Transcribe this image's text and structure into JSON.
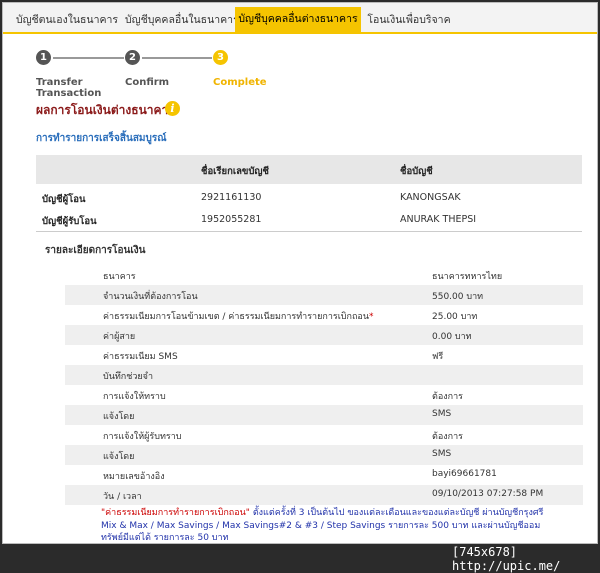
{
  "tabs": [
    {
      "label": "บัญชีตนเองในธนาคาร",
      "active": false
    },
    {
      "label": "บัญชีบุคคลอื่นในธนาคาร",
      "active": false
    },
    {
      "label": "บัญชีบุคคลอื่นต่างธนาคาร",
      "active": true
    },
    {
      "label": "โอนเงินเพื่อบริจาค",
      "active": false
    }
  ],
  "steps": [
    {
      "number": "1",
      "label": "Transfer Transaction"
    },
    {
      "number": "2",
      "label": "Confirm"
    },
    {
      "number": "3",
      "label": "Complete"
    }
  ],
  "result_title": "ผลการโอนเงินต่างธนาคาร",
  "info_icon_glyph": "i",
  "complete_message": "การทำรายการเสร็จสิ้นสมบูรณ์",
  "accounts_table": {
    "headers": [
      "",
      "ชื่อเรียกเลขบัญชี",
      "ชื่อบัญชี"
    ],
    "rows": [
      {
        "label": "บัญชีผู้โอน",
        "number": "2921161130",
        "name": "KANONGSAK"
      },
      {
        "label": "บัญชีผู้รับโอน",
        "number": "1952055281",
        "name": "ANURAK THEPSI"
      }
    ]
  },
  "details_title": "รายละเอียดการโอนเงิน",
  "details": [
    {
      "label": "ธนาคาร",
      "value": "ธนาคารทหารไทย"
    },
    {
      "label": "จำนวนเงินที่ต้องการโอน",
      "value": "550.00 บาท"
    },
    {
      "label": "ค่าธรรมเนียมการโอนข้ามเขต / ค่าธรรมเนียมการทำรายการเบิกถอน",
      "value": "25.00 บาท"
    },
    {
      "label": "ค่าผู้สาย",
      "value": "0.00 บาท"
    },
    {
      "label": "ค่าธรรมเนียม SMS",
      "value": "ฟรี"
    },
    {
      "label": "บันทึกช่วยจำ",
      "value": ""
    },
    {
      "label": "การแจ้งให้ทราบ",
      "value": "ต้องการ"
    },
    {
      "label": "แจ้งโดย",
      "value": "SMS"
    },
    {
      "label": "การแจ้งให้ผู้รับทราบ",
      "value": "ต้องการ"
    },
    {
      "label": "แจ้งโดย",
      "value": "SMS"
    },
    {
      "label": "หมายเลขอ้างอิง",
      "value": "bayi69661781"
    },
    {
      "label": "วัน / เวลา",
      "value": "09/10/2013 07:27:58 PM"
    }
  ],
  "required_mark": "*",
  "note": {
    "quoted": "\"ค่าธรรมเนียมการทำรายการเบิกถอน\"",
    "text": " ตั้งแต่ครั้งที่ 3 เป็นต้นไป ของแต่ละเดือนและของแต่ละบัญชี ผ่านบัญชีกรุงศรี Mix & Max / Max Savings / Max Savings#2 & #3 / Step Savings รายการละ 500 บาท และผ่านบัญชีออมทรัพย์มีแต่ได้ รายการละ 50 บาท"
  },
  "watermark": "[745x678] http://upic.me/",
  "colors": {
    "accent": "#f5c400",
    "title": "#8b1a1a",
    "link": "#2a6ebb",
    "note": "#2233aa"
  }
}
